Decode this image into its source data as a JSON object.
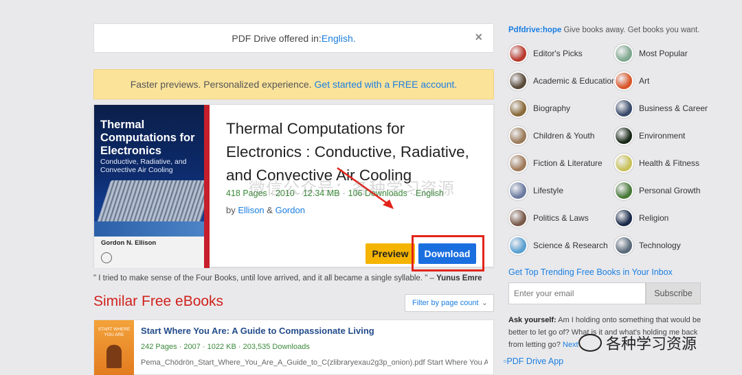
{
  "lang_bar": {
    "prefix": "PDF Drive offered in: ",
    "language": "English.",
    "close": "×"
  },
  "promo": {
    "text": "Faster previews. Personalized experience.",
    "link": "Get started with a FREE account."
  },
  "book": {
    "cover_title": "Thermal Computations for Electronics",
    "cover_subtitle": "Conductive, Radiative, and Convective Air Cooling",
    "cover_author": "Gordon N. Ellison",
    "title": "Thermal Computations for Electronics : Conductive, Radiative, and Convective Air Cooling",
    "pages": "418 Pages",
    "year": "2010",
    "size": "12.34 MB",
    "downloads": "106 Downloads",
    "language": "English",
    "by_label": "by",
    "author1": "Ellison",
    "ampersand": "&",
    "author2": "Gordon",
    "preview_label": "Preview",
    "download_label": "Download"
  },
  "quote": {
    "text": "\" I tried to make sense of the Four Books, until love arrived, and it all became a single syllable. \" –",
    "author": "Yunus Emre"
  },
  "similar": {
    "title": "Similar Free eBooks",
    "filter_label": "Filter by page count",
    "items": [
      {
        "title": "Start Where You Are: A Guide to Compassionate Living",
        "cover_text": "START WHERE YOU ARE",
        "meta": "242 Pages · 2007 · 1022 KB · 203,535 Downloads",
        "desc": "Pema_Chödrön_Start_Where_You_Are_A_Guide_to_C(zlibraryexau2g3p_onion).pdf Start Where You Are"
      }
    ]
  },
  "sidebar": {
    "brand": "Pdfdrive:hope",
    "tagline": " Give books away. Get books you want.",
    "categories": [
      {
        "label": "Editor's Picks",
        "color": "#b93a2e"
      },
      {
        "label": "Most Popular",
        "color": "#7fa88f"
      },
      {
        "label": "Academic & Education",
        "color": "#5a4a3a"
      },
      {
        "label": "Art",
        "color": "#d9562a"
      },
      {
        "label": "Biography",
        "color": "#8a6a3a"
      },
      {
        "label": "Business & Career",
        "color": "#3a4a6a"
      },
      {
        "label": "Children & Youth",
        "color": "#9a7a5a"
      },
      {
        "label": "Environment",
        "color": "#1a2a1a"
      },
      {
        "label": "Fiction & Literature",
        "color": "#a07a5a"
      },
      {
        "label": "Health & Fitness",
        "color": "#c9c25a"
      },
      {
        "label": "Lifestyle",
        "color": "#6a7aa0"
      },
      {
        "label": "Personal Growth",
        "color": "#4a7a3a"
      },
      {
        "label": "Politics & Laws",
        "color": "#7a5a4a"
      },
      {
        "label": "Religion",
        "color": "#1a2a4a"
      },
      {
        "label": "Science & Research",
        "color": "#5aa0d0"
      },
      {
        "label": "Technology",
        "color": "#5a6a7a"
      }
    ],
    "newsletter_title": "Get Top Trending Free Books in Your Inbox",
    "email_placeholder": "Enter your email",
    "subscribe_label": "Subscribe",
    "ask_label": "Ask yourself:",
    "ask_text": " Am I holding onto something that would be better to let go of? What is it and what's holding me back from letting go?",
    "ask_next": "Next",
    "app_link": "PDF Drive App"
  },
  "watermarks": {
    "center": "微信公众号：各种学习资源",
    "corner": "各种学习资源"
  }
}
